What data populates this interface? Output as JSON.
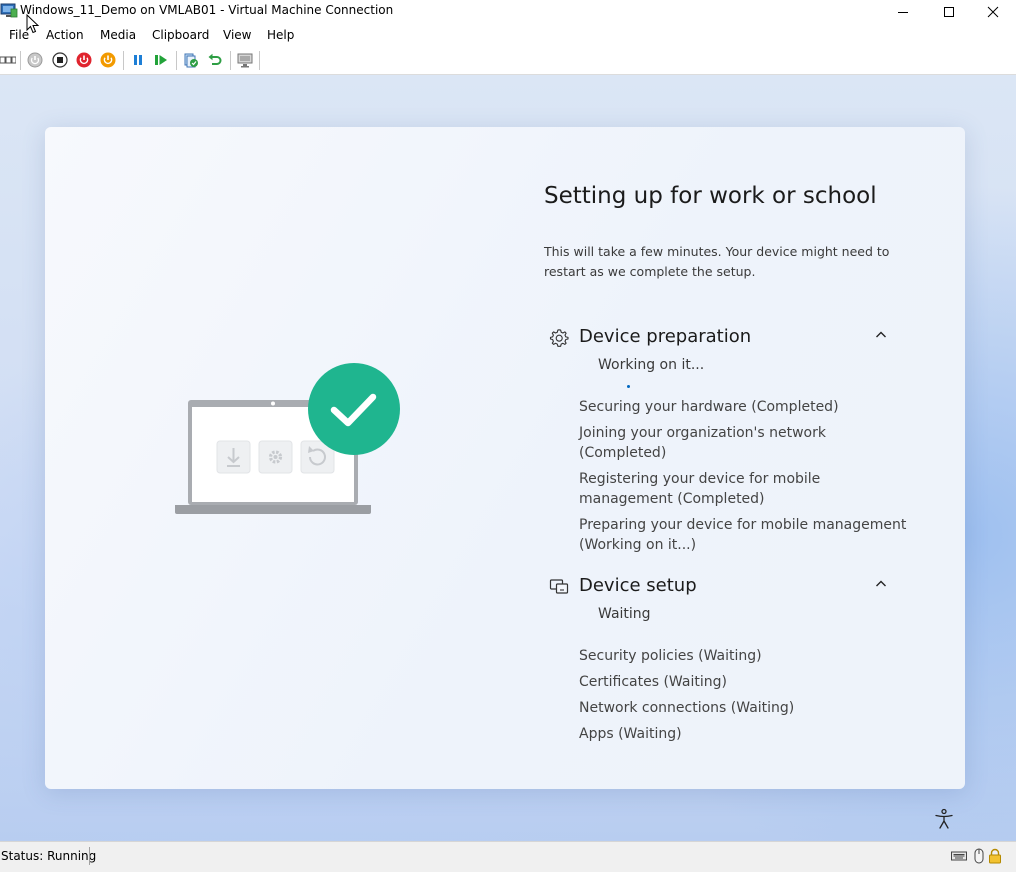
{
  "window": {
    "title": "Windows_11_Demo on VMLAB01 - Virtual Machine Connection",
    "controls": [
      "minimize-icon",
      "maximize-icon",
      "close-icon"
    ]
  },
  "menu": {
    "items": [
      "File",
      "Action",
      "Media",
      "Clipboard",
      "View",
      "Help"
    ]
  },
  "toolbar": {
    "icons": [
      "ctrl-alt-del-icon",
      "start-icon",
      "turn-off-icon",
      "shut-down-icon",
      "power-icon",
      "pause-icon",
      "resume-icon",
      "checkpoint-icon",
      "revert-icon",
      "enhanced-session-icon"
    ]
  },
  "setup": {
    "heading": "Setting up for work or school",
    "subtitle": "This will take a few minutes. Your device might need to restart as we complete the setup.",
    "sections": [
      {
        "title": "Device preparation",
        "status": "Working on it...",
        "steps": [
          "Securing your hardware (Completed)",
          "Joining your organization's network (Completed)",
          "Registering your device for mobile management (Completed)",
          "Preparing your device for mobile management (Working on it...)"
        ]
      },
      {
        "title": "Device setup",
        "status": "Waiting",
        "steps": [
          "Security policies (Waiting)",
          "Certificates (Waiting)",
          "Network connections (Waiting)",
          "Apps (Waiting)"
        ]
      }
    ]
  },
  "colors": {
    "accent_blue": "#0067c0",
    "check_green": "#1fb58f",
    "power_red": "#e0242e",
    "power_orange": "#f29a00"
  },
  "statusbar": {
    "status": "Status: Running"
  }
}
